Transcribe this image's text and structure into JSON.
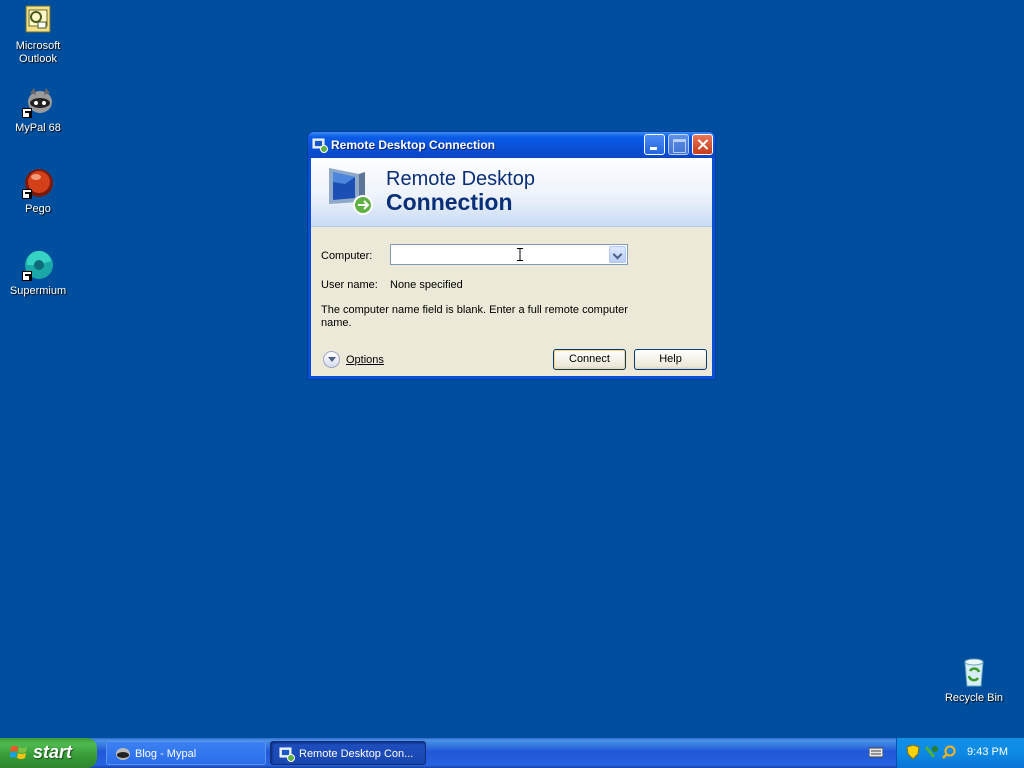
{
  "desktop": {
    "icons": [
      {
        "label_line1": "Microsoft",
        "label_line2": "Outlook"
      },
      {
        "label_line1": "MyPal 68",
        "label_line2": ""
      },
      {
        "label_line1": "Pego",
        "label_line2": ""
      },
      {
        "label_line1": "Supermium",
        "label_line2": ""
      }
    ],
    "recycle_bin": "Recycle Bin"
  },
  "window": {
    "title": "Remote Desktop Connection",
    "banner_line1": "Remote Desktop",
    "banner_line2": "Connection",
    "computer_label": "Computer:",
    "computer_value": "",
    "username_label": "User name:",
    "username_value": "None specified",
    "message": "The computer name field is blank. Enter a full remote computer name.",
    "options_label": "Options",
    "connect_label": "Connect",
    "help_label": "Help"
  },
  "taskbar": {
    "start_label": "start",
    "tasks": [
      {
        "label": "Blog - Mypal"
      },
      {
        "label": "Remote Desktop Con..."
      }
    ],
    "clock": "9:43 PM"
  },
  "colors": {
    "desktop": "#004f9e",
    "titlebar": "#0a4fd6",
    "taskbar": "#2157d7",
    "start": "#379a37"
  }
}
